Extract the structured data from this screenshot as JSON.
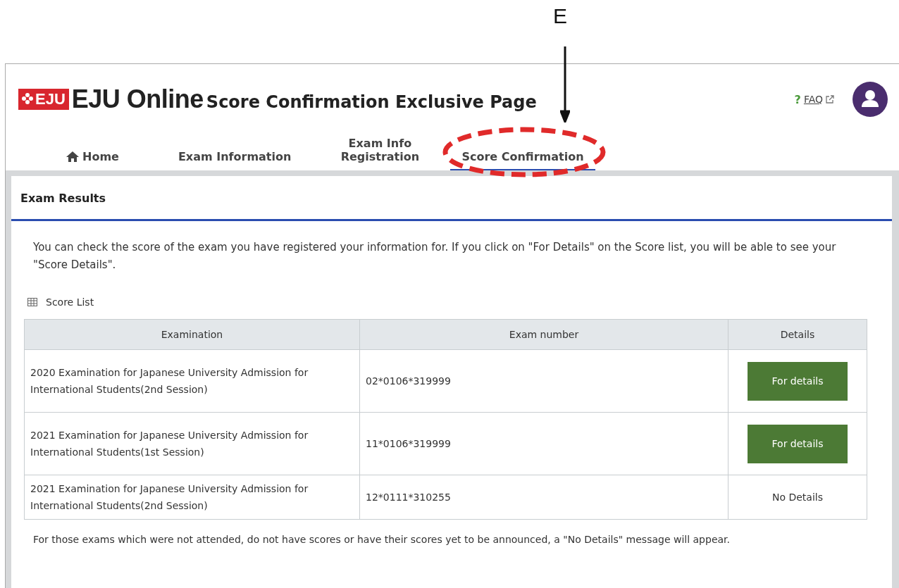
{
  "annotation": {
    "label": "E"
  },
  "header": {
    "logo_text": "EJU",
    "title": "EJU Online",
    "subtitle": "Score Confirmation Exclusive Page",
    "faq": {
      "mark": "?",
      "label": "FAQ"
    }
  },
  "nav": [
    {
      "kind": "home",
      "label": "Home",
      "selected": false
    },
    {
      "kind": "text",
      "label": "Exam Information",
      "selected": false
    },
    {
      "kind": "text",
      "label": "Exam Info Registration",
      "selected": false
    },
    {
      "kind": "text",
      "label": "Score Confirmation",
      "selected": true
    }
  ],
  "card": {
    "title": "Exam Results",
    "intro": "You can check the score of the exam you have registered your information for. If you click on \"For Details\" on the Score list, you will be able to see your \"Score Details\".",
    "list_title": "Score List",
    "table": {
      "columns": [
        "Examination",
        "Exam number",
        "Details"
      ],
      "rows": [
        {
          "examination": "2020 Examination for Japanese University Admission for International Students(2nd Session)",
          "exam_number": "02*0106*319999",
          "details": {
            "kind": "button",
            "label": "For details"
          }
        },
        {
          "examination": "2021 Examination for Japanese University Admission for International Students(1st Session)",
          "exam_number": "11*0106*319999",
          "details": {
            "kind": "button",
            "label": "For details"
          }
        },
        {
          "examination": "2021 Examination for Japanese University Admission for International Students(2nd Session)",
          "exam_number": "12*0111*310255",
          "details": {
            "kind": "text",
            "label": "No Details"
          }
        }
      ]
    },
    "note": "For those exams which were not attended, do not have scores or have their scores yet to be announced, a \"No Details\" message will appear."
  }
}
